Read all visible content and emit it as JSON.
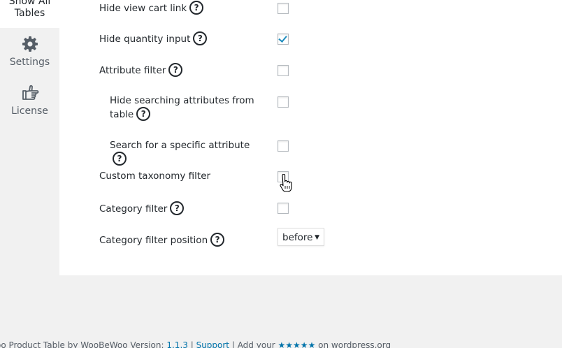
{
  "sidebar": {
    "items": [
      {
        "label_line1": "Show All",
        "label_line2": "Tables",
        "icon": "table-icon"
      },
      {
        "label": "Settings",
        "icon": "gear-icon"
      },
      {
        "label": "License",
        "icon": "thumb-right-icon"
      }
    ]
  },
  "settings": {
    "rows": [
      {
        "label": "Hide view cart link",
        "checked": false
      },
      {
        "label": "Hide quantity input",
        "checked": true
      },
      {
        "label": "Attribute filter",
        "checked": false
      },
      {
        "label_line1": "Hide searching attributes from",
        "label_line2": "table",
        "checked": false
      },
      {
        "label": "Search for a specific attribute",
        "checked": false
      },
      {
        "label": "Custom taxonomy filter",
        "checked": false
      },
      {
        "label": "Category filter",
        "checked": false
      },
      {
        "label": "Category filter position",
        "select_value": "before"
      }
    ],
    "help_glyph": "?"
  },
  "footer": {
    "prefix": "oo Product Table by WooBeWoo Version: ",
    "version": "1.1.3",
    "sep1": " | ",
    "support": "Support",
    "sep2": " | Add your ",
    "stars": "★★★★★",
    "suffix": " on wordpress.org"
  }
}
